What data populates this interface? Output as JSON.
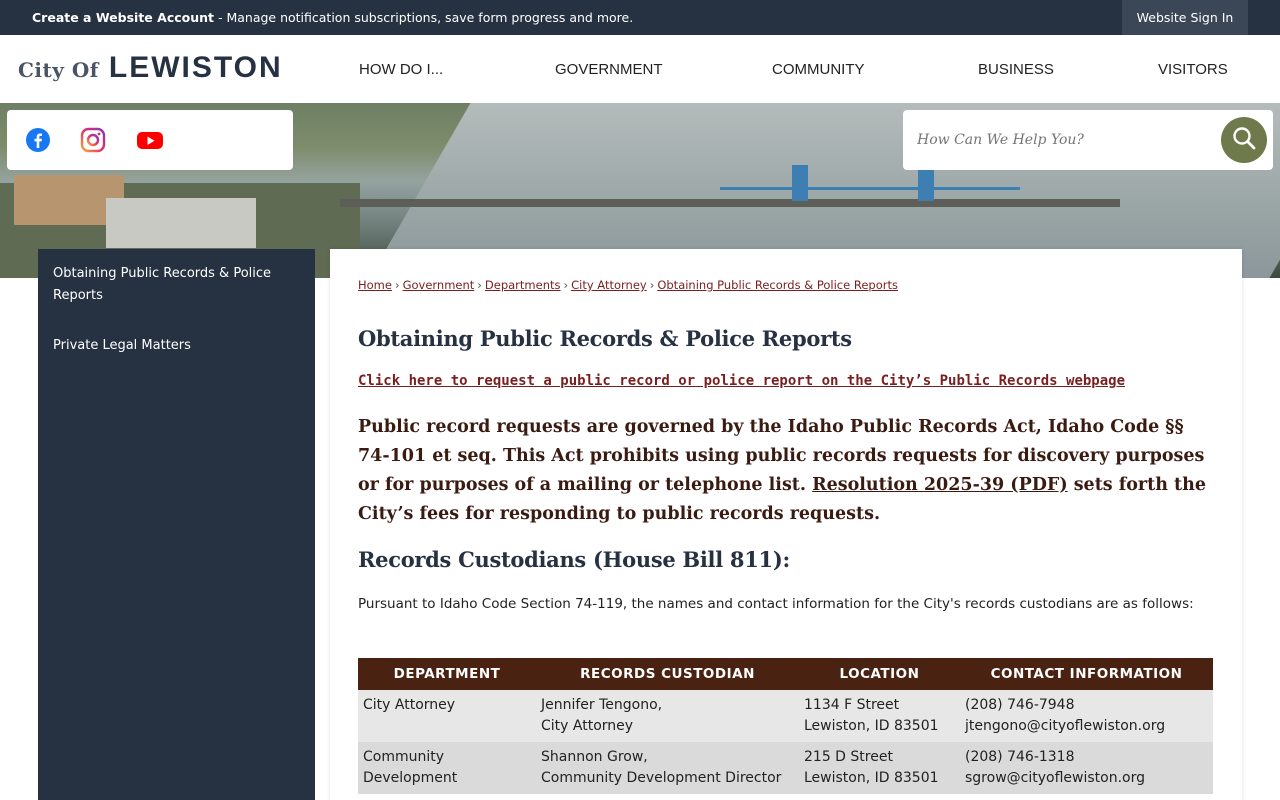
{
  "topbar": {
    "notice_bold": "Create a Website Account",
    "notice_rest": " - Manage notification subscriptions, save form progress and more.",
    "signin": "Website Sign In"
  },
  "header": {
    "logo_city": "City Of",
    "logo_name": "LEWISTON",
    "nav": [
      "HOW DO I...",
      "GOVERNMENT",
      "COMMUNITY",
      "BUSINESS",
      "VISITORS"
    ]
  },
  "social": {
    "icons": [
      "facebook-icon",
      "instagram-icon",
      "youtube-icon"
    ],
    "colors": {
      "facebook": "#1877f2",
      "instagram": "#c13584",
      "youtube": "#ff0000"
    }
  },
  "search": {
    "placeholder": "How Can We Help You?",
    "button_color": "#6e7a4b"
  },
  "sidebar": {
    "items": [
      "Obtaining Public Records & Police Reports",
      "Private Legal Matters"
    ]
  },
  "breadcrumb": {
    "items": [
      "Home",
      "Government",
      "Departments",
      "City Attorney",
      "Obtaining Public Records & Police Reports"
    ],
    "separator": "›"
  },
  "page": {
    "title": "Obtaining Public Records & Police Reports",
    "request_link": "Click here to request a public record or police report on the City’s Public Records webpage",
    "para_before": "Public record requests are governed by the Idaho Public Records Act, Idaho Code §§ 74-101 et seq. This Act prohibits using public records requests for discovery purposes or for purposes of a mailing or telephone list. ",
    "para_link": "Resolution 2025-39 (PDF)",
    "para_after": " sets forth the City’s fees for responding to public records requests.",
    "custodians_heading": "Records Custodians (House Bill 811):",
    "custodians_intro": "Pursuant to Idaho Code Section 74-119, the names and contact information for the City's records custodians are as follows:"
  },
  "table": {
    "headers": [
      "DEPARTMENT",
      "RECORDS CUSTODIAN",
      "LOCATION",
      "CONTACT INFORMATION"
    ],
    "rows": [
      {
        "department": [
          "City Attorney"
        ],
        "custodian": [
          "Jennifer Tengono,",
          "City Attorney"
        ],
        "location": [
          "1134 F Street",
          "Lewiston, ID 83501"
        ],
        "contact": [
          "(208) 746-7948",
          "jtengono@cityoflewiston.org"
        ]
      },
      {
        "department": [
          "Community",
          "Development"
        ],
        "custodian": [
          "Shannon Grow,",
          "Community Development Director"
        ],
        "location": [
          "215 D Street",
          "Lewiston, ID 83501"
        ],
        "contact": [
          "(208) 746-1318",
          "sgrow@cityoflewiston.org"
        ]
      }
    ]
  },
  "colors": {
    "navy": "#263142",
    "header_brown": "#4a2211",
    "link_maroon": "#7a1f1f"
  }
}
